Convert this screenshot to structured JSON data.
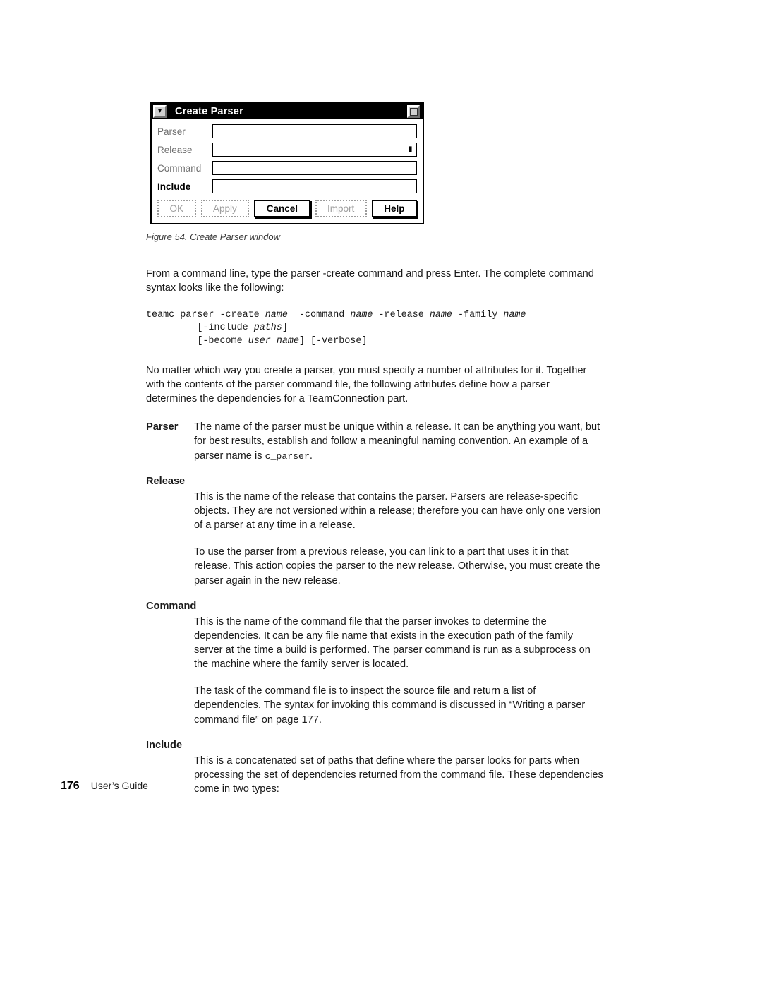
{
  "figure": {
    "dialog": {
      "title": "Create Parser",
      "menu_icon": "window-menu-icon",
      "maximize_icon": "maximize-icon",
      "fields": [
        {
          "label": "Parser",
          "value": "",
          "enabled": false,
          "dropdown": false
        },
        {
          "label": "Release",
          "value": "",
          "enabled": false,
          "dropdown": true
        },
        {
          "label": "Command",
          "value": "",
          "enabled": false,
          "dropdown": false
        },
        {
          "label": "Include",
          "value": "",
          "enabled": true,
          "dropdown": false
        }
      ],
      "buttons": [
        {
          "label": "OK",
          "enabled": false
        },
        {
          "label": "Apply",
          "enabled": false
        },
        {
          "label": "Cancel",
          "enabled": true
        },
        {
          "label": "Import",
          "enabled": false
        },
        {
          "label": "Help",
          "enabled": true
        }
      ]
    },
    "caption": "Figure 54. Create Parser window"
  },
  "content": {
    "intro_paragraph": "From a command line, type the parser -create command and press Enter. The complete command syntax looks like the following:",
    "code_block": {
      "line1_a": "teamc parser -create ",
      "line1_name1": "name",
      "line1_b": "  -command ",
      "line1_name2": "name",
      "line1_c": " -release ",
      "line1_name3": "name",
      "line1_d": " -family ",
      "line1_name4": "name",
      "line2_a": "         [-include ",
      "line2_paths": "paths",
      "line2_b": "]",
      "line3_a": "         [-become ",
      "line3_user": "user_name",
      "line3_b": "] [-verbose]"
    },
    "attributes_paragraph": "No matter which way you create a parser, you must specify a number of attributes for it. Together with the contents of the parser command file, the following attributes define how a parser determines the dependencies for a TeamConnection part.",
    "terms": {
      "parser": {
        "term": "Parser",
        "def_a": "The name of the parser must be unique within a release. It can be anything you want, but for best results, establish and follow a meaningful naming convention. An example of a parser name is ",
        "def_code": "c_parser",
        "def_b": "."
      },
      "release": {
        "term": "Release",
        "def1": "This is the name of the release that contains the parser. Parsers are release-specific objects. They are not versioned within a release; therefore you can have only one version of a parser at any time in a release.",
        "def2": "To use the parser from a previous release, you can link to a part that uses it in that release. This action copies the parser to the new release. Otherwise, you must create the parser again in the new release."
      },
      "command": {
        "term": "Command",
        "def1": "This is the name of the command file that the parser invokes to determine the dependencies. It can be any file name that exists in the execution path of the family server at the time a build is performed. The parser command is run as a subprocess on the machine where the family server is located.",
        "def2": "The task of the command file is to inspect the source file and return a list of dependencies. The syntax for invoking this command is discussed in “Writing a parser command file” on page 177."
      },
      "include": {
        "term": "Include",
        "def1": "This is a concatenated set of paths that define where the parser looks for parts when processing the set of dependencies returned from the command file. These dependencies come in two types:"
      }
    }
  },
  "footer": {
    "page_number": "176",
    "document_title": "User’s Guide"
  },
  "colors": {
    "titlebar_bg": "#000000",
    "titlebar_text": "#ffffff",
    "disabled_text": "#9e9e9e",
    "page_bg": "#ffffff"
  }
}
